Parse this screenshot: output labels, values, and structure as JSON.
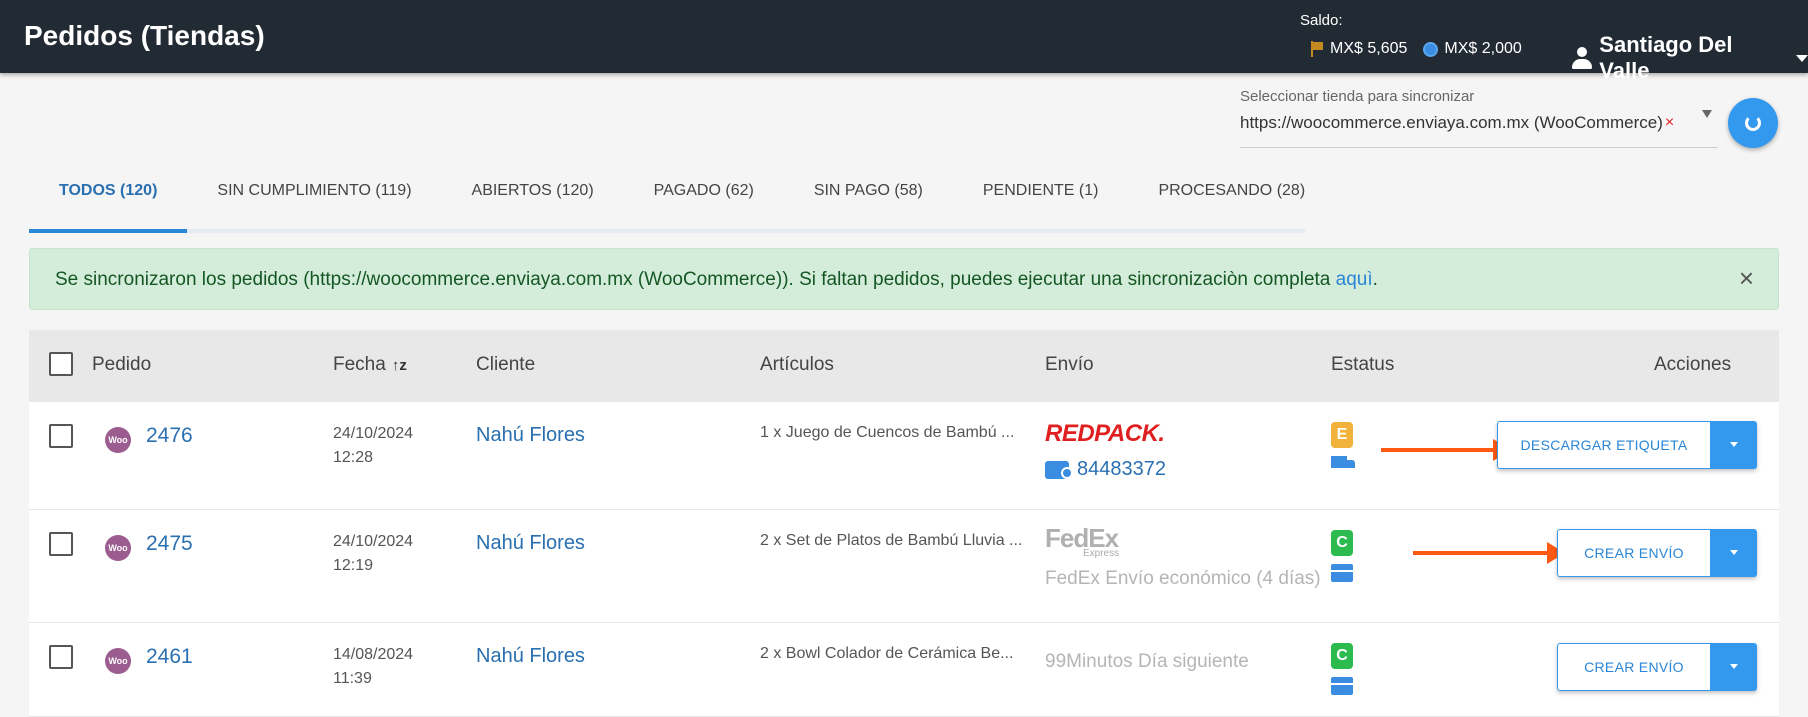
{
  "header": {
    "title": "Pedidos (Tiendas)",
    "saldo_label": "Saldo:",
    "balance_1": "MX$ 5,605",
    "balance_2": "MX$ 2,000",
    "user_name": "Santiago Del Valle"
  },
  "store_selector": {
    "label": "Seleccionar tienda para sincronizar",
    "value": "https://woocommerce.enviaya.com.mx (WooCommerce)",
    "clear": "×"
  },
  "tabs": [
    {
      "label": "TODOS (120)",
      "active": true
    },
    {
      "label": "SIN CUMPLIMIENTO (119)"
    },
    {
      "label": "ABIERTOS (120)"
    },
    {
      "label": "PAGADO (62)"
    },
    {
      "label": "SIN PAGO (58)"
    },
    {
      "label": "PENDIENTE (1)"
    },
    {
      "label": "PROCESANDO (28)"
    }
  ],
  "alert": {
    "text": "Se sincronizaron los pedidos (https://woocommerce.enviaya.com.mx (WooCommerce)). Si faltan pedidos, puedes ejecutar una sincronizaciòn completa ",
    "link": "aquì",
    "end": ".",
    "close": "×"
  },
  "table": {
    "headers": {
      "pedido": "Pedido",
      "fecha": "Fecha",
      "cliente": "Cliente",
      "articulos": "Artículos",
      "envio": "Envío",
      "estatus": "Estatus",
      "acciones": "Acciones"
    },
    "rows": [
      {
        "store_badge": "Woo",
        "order": "2476",
        "date": "24/10/2024",
        "time": "12:28",
        "client": "Nahú Flores",
        "items": "1 x Juego de Cuencos de Bambú ...",
        "carrier": "REDPACK.",
        "tracking": "84483372",
        "status": "E",
        "action": "DESCARGAR ETIQUETA"
      },
      {
        "store_badge": "Woo",
        "order": "2475",
        "date": "24/10/2024",
        "time": "12:19",
        "client": "Nahú Flores",
        "items": "2 x Set de Platos de Bambú Lluvia ...",
        "carrier": "FedEx",
        "carrier_sub": "Express",
        "service": "FedEx Envío económico (4 días)",
        "status": "C",
        "action": "CREAR ENVÍO"
      },
      {
        "store_badge": "Woo",
        "order": "2461",
        "date": "14/08/2024",
        "time": "11:39",
        "client": "Nahú Flores",
        "items": "2 x Bowl Colador de Cerámica Be...",
        "service": "99Minutos Día siguiente",
        "status": "C",
        "action": "CREAR ENVÍO"
      }
    ]
  },
  "colors": {
    "header_bg": "#222b33",
    "accent": "#2a86d6",
    "arrow": "#ff5a14",
    "alert_bg": "#d4edda"
  }
}
